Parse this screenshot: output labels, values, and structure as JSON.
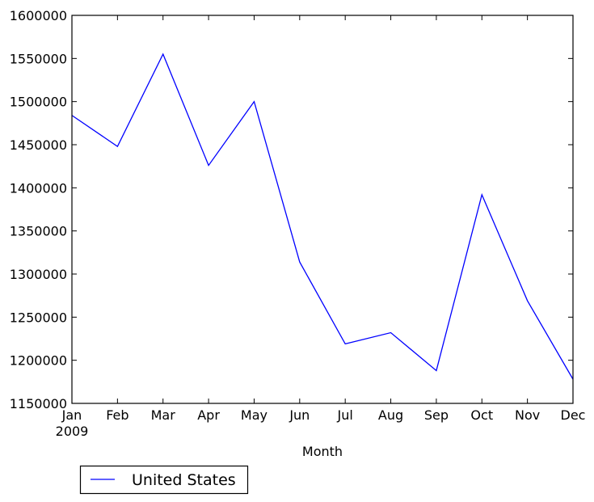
{
  "chart_data": {
    "type": "line",
    "title": "",
    "xlabel": "Month",
    "ylabel": "",
    "categories": [
      "Jan",
      "Feb",
      "Mar",
      "Apr",
      "May",
      "Jun",
      "Jul",
      "Aug",
      "Sep",
      "Oct",
      "Nov",
      "Dec"
    ],
    "x_sublabel": "2009",
    "series": [
      {
        "name": "United States",
        "color": "#0000ff",
        "values": [
          1484000,
          1448000,
          1555000,
          1426000,
          1500000,
          1314000,
          1219000,
          1232000,
          1188000,
          1392000,
          1269000,
          1178000
        ]
      }
    ],
    "ylim": [
      1150000,
      1600000
    ],
    "yticks": [
      1150000,
      1200000,
      1250000,
      1300000,
      1350000,
      1400000,
      1450000,
      1500000,
      1550000,
      1600000
    ],
    "ytick_labels": [
      "1150000",
      "1200000",
      "1250000",
      "1300000",
      "1350000",
      "1400000",
      "1450000",
      "1500000",
      "1550000",
      "1600000"
    ],
    "grid": false,
    "legend": {
      "placement": "bottom-left-outside",
      "entries": [
        "United States"
      ]
    }
  }
}
